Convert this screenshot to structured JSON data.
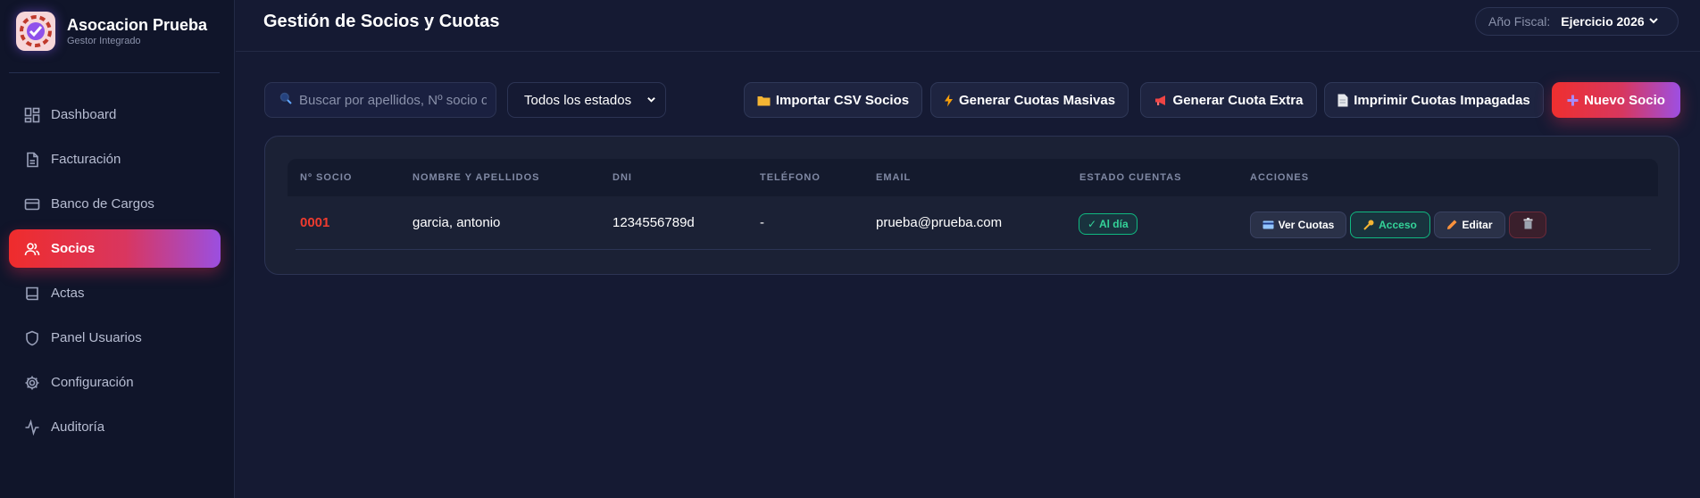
{
  "app": {
    "name": "Asocacion Prueba",
    "subtitle": "Gestor Integrado"
  },
  "sidebar": {
    "items": [
      {
        "label": "Dashboard",
        "icon": "dashboard-icon"
      },
      {
        "label": "Facturación",
        "icon": "document-icon"
      },
      {
        "label": "Banco de Cargos",
        "icon": "credit-card-icon"
      },
      {
        "label": "Socios",
        "icon": "users-icon",
        "active": true
      },
      {
        "label": "Actas",
        "icon": "book-icon"
      },
      {
        "label": "Panel Usuarios",
        "icon": "shield-icon"
      },
      {
        "label": "Configuración",
        "icon": "gear-icon"
      },
      {
        "label": "Auditoría",
        "icon": "activity-icon"
      }
    ]
  },
  "header": {
    "title": "Gestión de Socios y Cuotas",
    "fiscal_label": "Año Fiscal:",
    "fiscal_value": "Ejercicio 2026"
  },
  "toolbar": {
    "search_placeholder": "Buscar por apellidos, Nº socio o DNI...",
    "status_filter": "Todos los estados",
    "buttons": {
      "import": "Importar CSV Socios",
      "generate_bulk": "Generar Cuotas Masivas",
      "generate_extra": "Generar Cuota Extra",
      "print_unpaid": "Imprimir Cuotas Impagadas",
      "new_member": "Nuevo Socio"
    }
  },
  "table": {
    "columns": [
      "Nº SOCIO",
      "NOMBRE Y APELLIDOS",
      "DNI",
      "TELÉFONO",
      "EMAIL",
      "ESTADO CUENTAS",
      "ACCIONES"
    ],
    "rows": [
      {
        "number": "0001",
        "name": "garcia, antonio",
        "dni": "1234556789d",
        "phone": "-",
        "email": "prueba@prueba.com",
        "status": "✓ Al día"
      }
    ],
    "actions": {
      "view": "Ver Cuotas",
      "access": "Acceso",
      "edit": "Editar"
    }
  },
  "colors": {
    "accent_red": "#ef2c2c",
    "accent_purple": "#9b4fe0",
    "success": "#10b981",
    "background": "#151a33"
  }
}
